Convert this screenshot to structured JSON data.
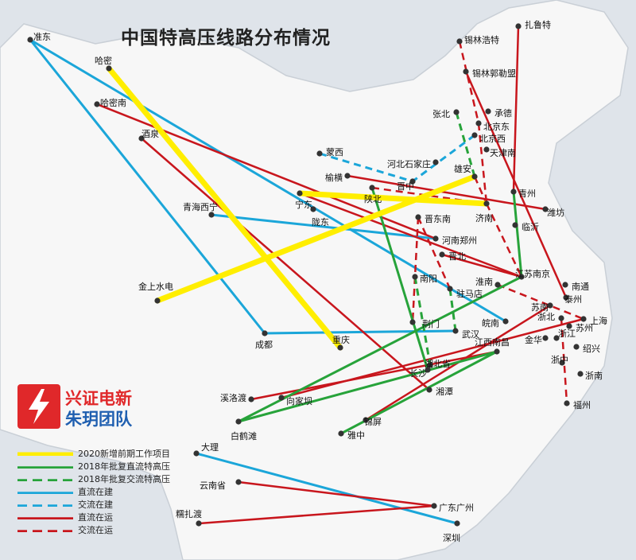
{
  "title": "中国特高压线路分布情况",
  "logo": {
    "line1": "兴证电新",
    "line2": "朱玥团队"
  },
  "colors": {
    "yellow": "#ffee00",
    "green": "#27a33a",
    "blue": "#1ba6d9",
    "red": "#c8161d",
    "land": "#f7f7f7",
    "border": "#c9cfd6",
    "sea": "#dfe4ea"
  },
  "legend": [
    {
      "label": "2020新增前期工作项目",
      "color": "#ffee00",
      "style": "solid",
      "icon": "thick-line"
    },
    {
      "label": "2018年批复直流特高压",
      "color": "#27a33a",
      "style": "solid"
    },
    {
      "label": "2018年批复交流特高压",
      "color": "#27a33a",
      "style": "dashed"
    },
    {
      "label": "直流在建",
      "color": "#1ba6d9",
      "style": "solid"
    },
    {
      "label": "交流在建",
      "color": "#1ba6d9",
      "style": "dashed"
    },
    {
      "label": "直流在运",
      "color": "#c8161d",
      "style": "solid"
    },
    {
      "label": "交流在运",
      "color": "#c8161d",
      "style": "dashed"
    }
  ],
  "places": [
    "准东",
    "哈密",
    "哈密南",
    "酒泉",
    "锡林浩特",
    "扎鲁特",
    "锡林郭勒盟",
    "承德",
    "张北",
    "北京东",
    "北京西",
    "天津南",
    "蒙西",
    "河北石家庄",
    "雄安",
    "榆横",
    "陕北",
    "晋中",
    "宁东",
    "陇东",
    "青海西宁",
    "晋东南",
    "济南",
    "潍坊",
    "青州",
    "河南郑州",
    "临沂",
    "晋北",
    "南阳",
    "驻马店",
    "江苏南京",
    "淮南",
    "南通",
    "泰州",
    "苏南",
    "上海",
    "皖南",
    "苏州",
    "荆门",
    "武汉",
    "浙北",
    "浙江",
    "绍兴",
    "金上水电",
    "成都",
    "重庆",
    "江西南昌",
    "金华",
    "浙中",
    "浙南",
    "福州",
    "长沙",
    "湖北省",
    "湘潭",
    "溪洛渡",
    "向家坝",
    "锦屏",
    "白鹤滩",
    "雅中",
    "大理",
    "云南省",
    "广东广州",
    "糯扎渡",
    "深圳"
  ]
}
